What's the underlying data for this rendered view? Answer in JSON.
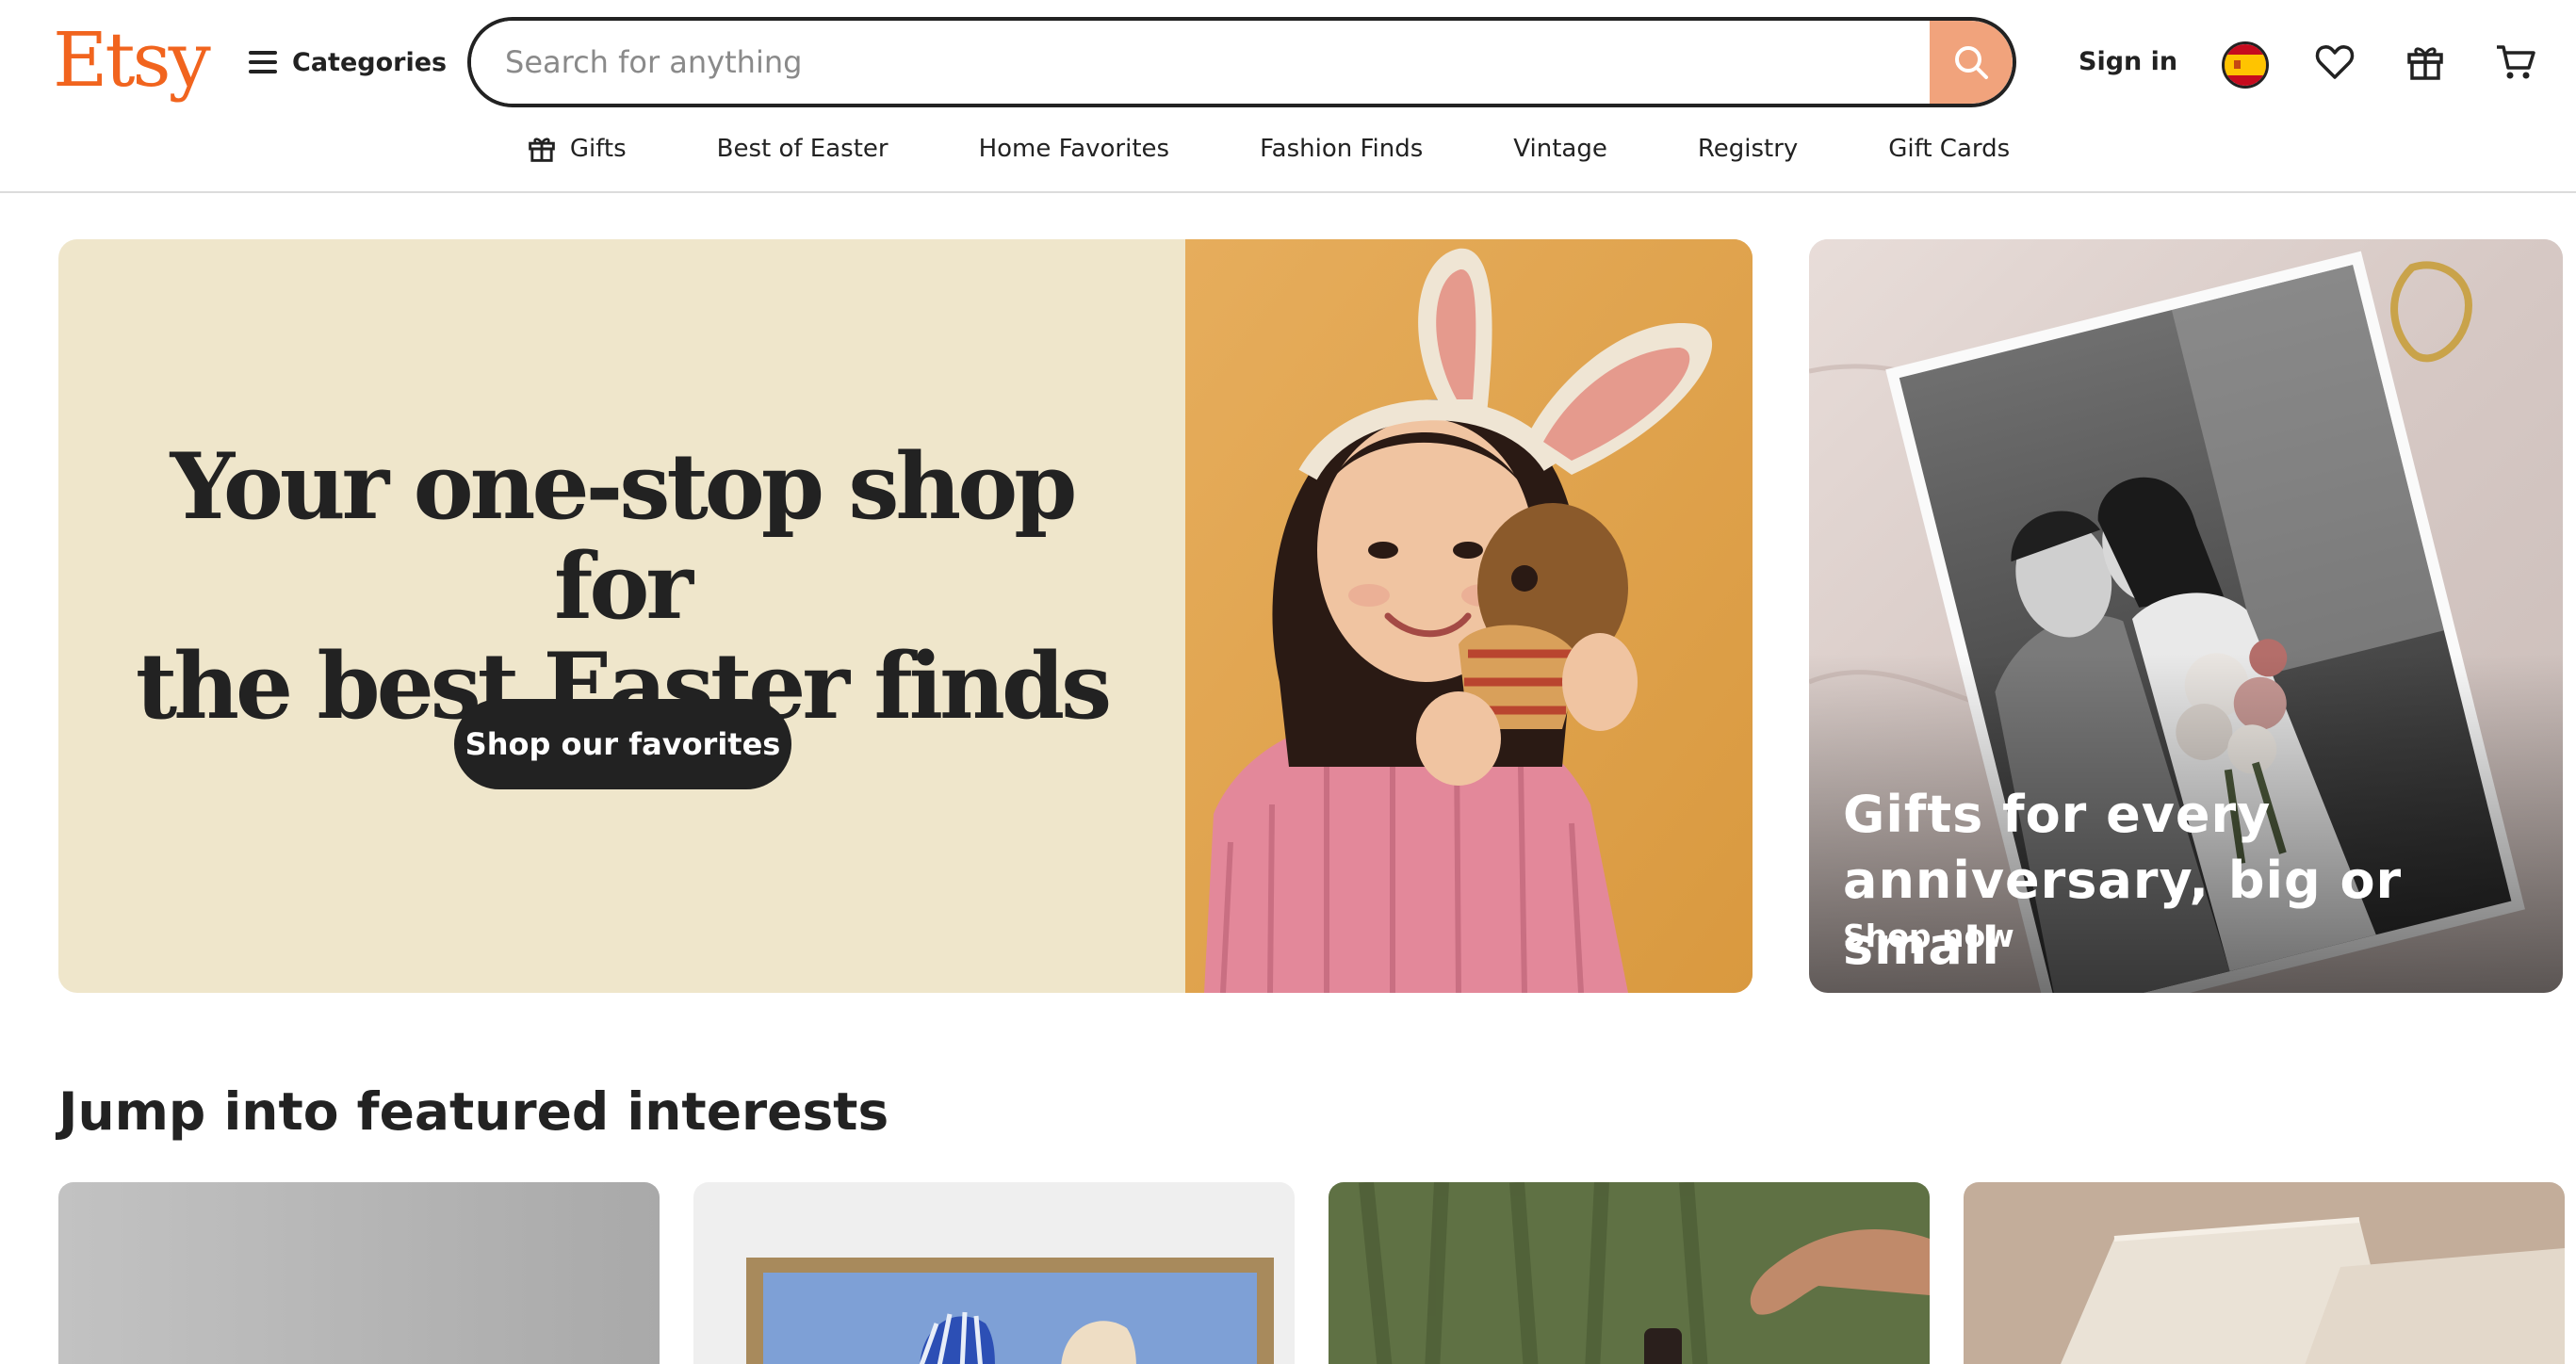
{
  "header": {
    "logo": "Etsy",
    "categories_label": "Categories",
    "search_placeholder": "Search for anything",
    "signin_label": "Sign in"
  },
  "nav": {
    "items": [
      "Gifts",
      "Best of Easter",
      "Home Favorites",
      "Fashion Finds",
      "Vintage",
      "Registry",
      "Gift Cards"
    ]
  },
  "hero": {
    "title_line1": "Your one-stop shop for",
    "title_line2": "the best Easter finds",
    "button_label": "Shop our favorites"
  },
  "side_card": {
    "title": "Gifts for every anniversary, big or small",
    "link_label": "Shop now"
  },
  "featured": {
    "title": "Jump into featured interests"
  },
  "colors": {
    "brand": "#f1641e",
    "search_button": "#f1a37c",
    "hero_bg": "#efe6cb",
    "dark": "#222222"
  },
  "icons": [
    "menu-icon",
    "search-icon",
    "spain-flag-icon",
    "heart-icon",
    "gift-icon",
    "cart-icon"
  ]
}
